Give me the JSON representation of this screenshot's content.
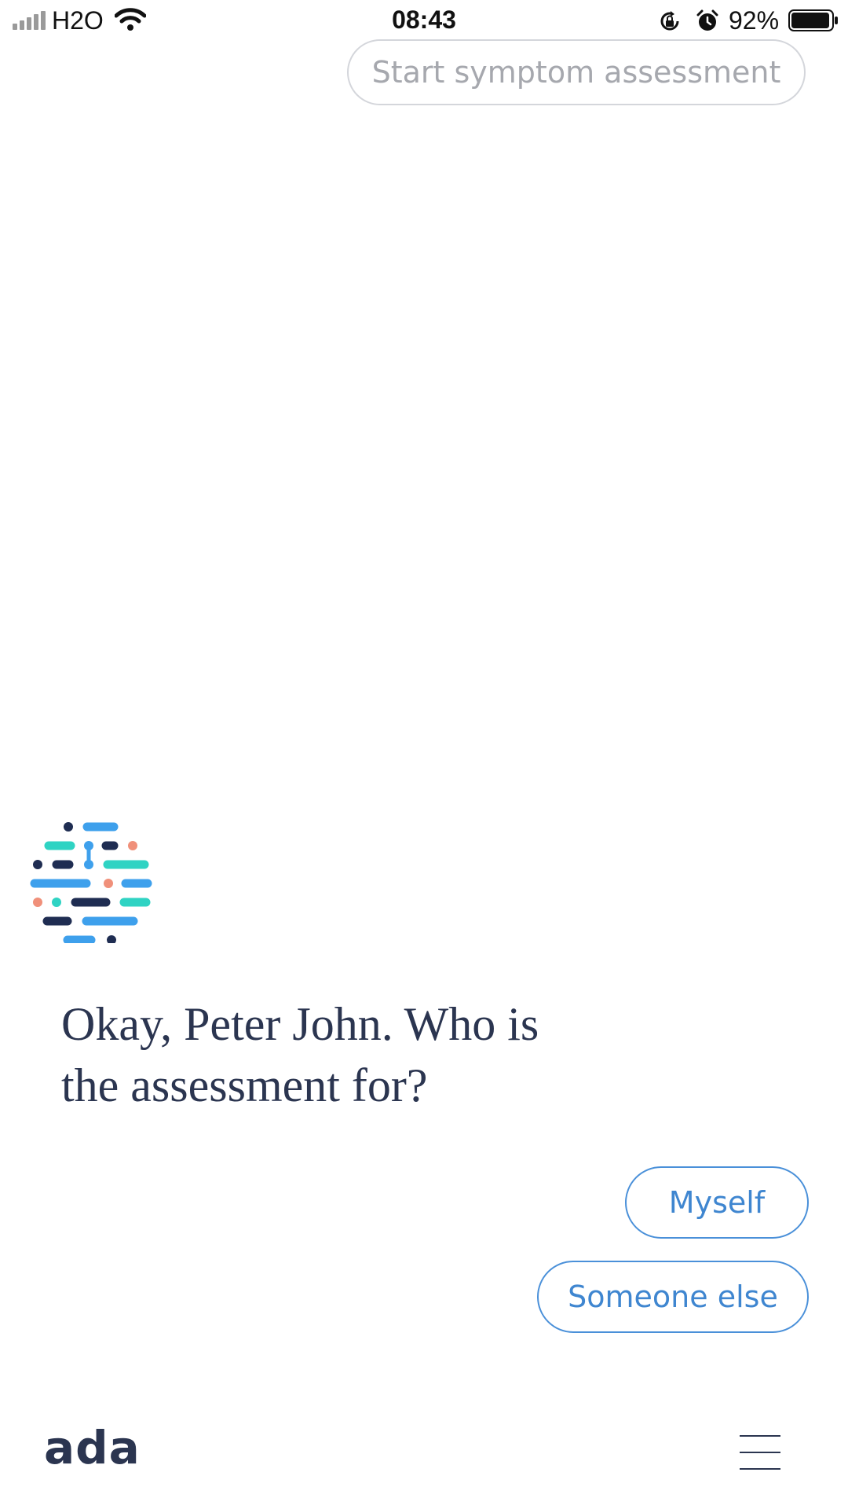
{
  "status_bar": {
    "carrier": "H2O",
    "time": "08:43",
    "battery_percent": "92%",
    "icons": [
      "signal-icon",
      "wifi-icon",
      "rotation-lock-icon",
      "alarm-icon",
      "battery-icon"
    ]
  },
  "chat": {
    "previous_action": "Start symptom assessment",
    "question": "Okay, Peter John. Who is the assessment for?",
    "answers": [
      {
        "label": "Myself"
      },
      {
        "label": "Someone else"
      }
    ]
  },
  "footer": {
    "brand": "ada",
    "menu_icon": "hamburger-menu-icon"
  },
  "colors": {
    "text_dark": "#2b3550",
    "accent_blue": "#4a90d9",
    "pill_border": "#d4d6db",
    "pill_text": "#a6a8ae",
    "logo_teal": "#2fd3c3",
    "logo_blue": "#3ea0ec",
    "logo_navy": "#1f2d52",
    "logo_coral": "#f0907a"
  }
}
